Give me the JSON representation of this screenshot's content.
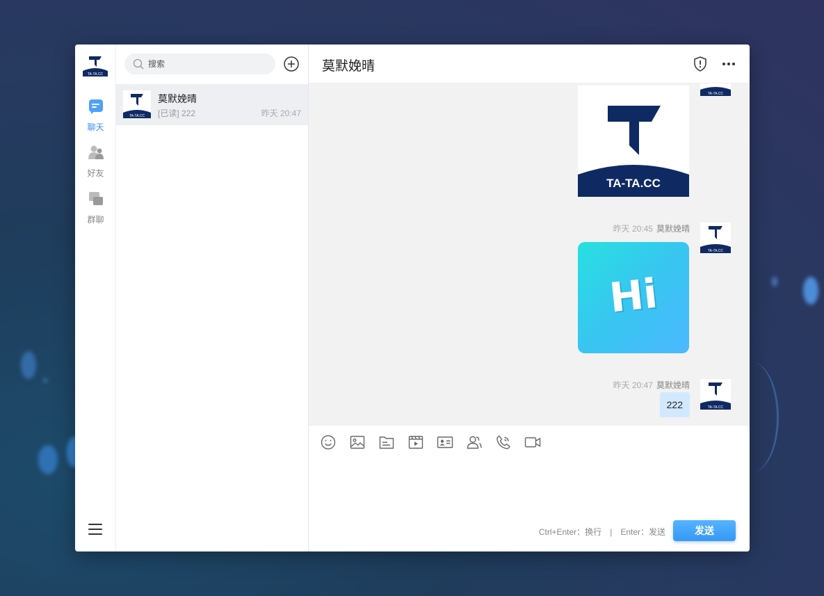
{
  "nav": {
    "items": [
      {
        "label": "聊天",
        "active": true
      },
      {
        "label": "好友",
        "active": false
      },
      {
        "label": "群聊",
        "active": false
      }
    ]
  },
  "list": {
    "search_placeholder": "搜索",
    "conversations": [
      {
        "name": "莫默娩晴",
        "preview": "[已读] 222",
        "time": "昨天 20:47"
      }
    ]
  },
  "chat": {
    "title": "莫默娩晴",
    "messages": [
      {
        "type": "image",
        "image": "logo",
        "logo_text": "TA-TA.CC"
      },
      {
        "type": "image",
        "image": "hi-sticker",
        "time": "昨天 20:45",
        "sender": "莫默娩晴",
        "sticker_text": "Hi"
      },
      {
        "type": "text",
        "time": "昨天 20:47",
        "sender": "莫默娩晴",
        "text": "222"
      }
    ],
    "composer": {
      "hint_newline": "Ctrl+Enter：换行",
      "hint_separator": "|",
      "hint_send": "Enter：发送",
      "send_label": "发送"
    }
  },
  "brand": {
    "logo_text": "TA-TA.CC",
    "navy": "#0f2a63",
    "accent": "#3a8ef0"
  }
}
